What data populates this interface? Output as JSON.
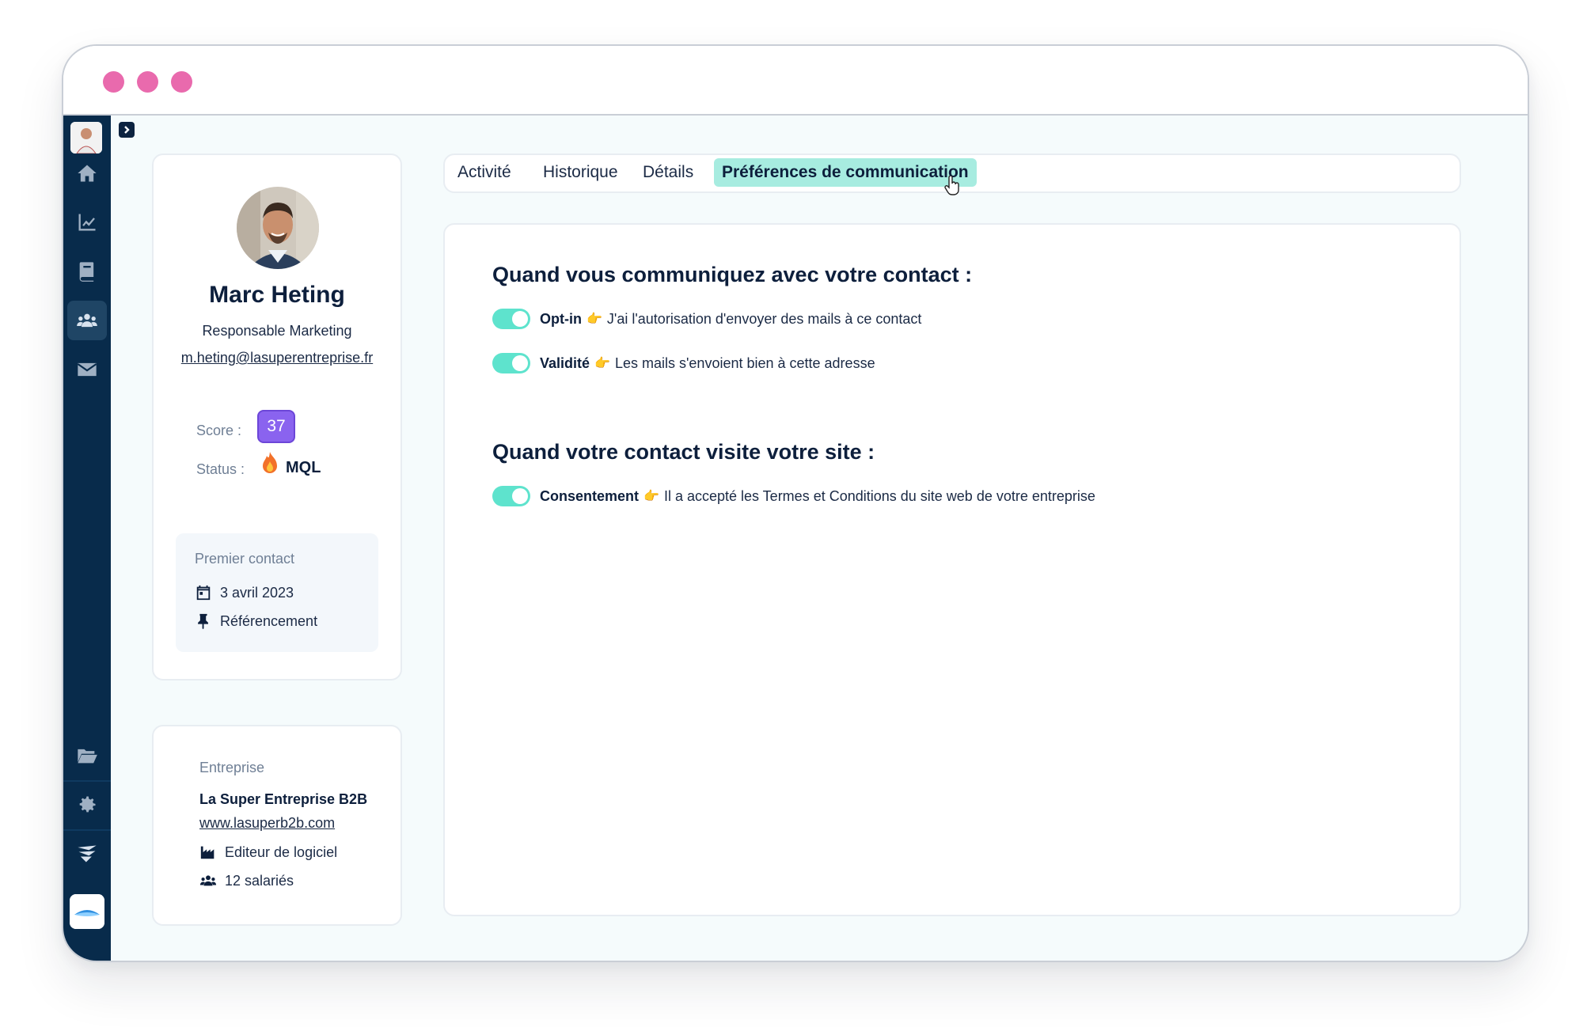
{
  "colors": {
    "accent": "#5ee3cd",
    "sidebar": "#082b4b",
    "score": "#8a63ef",
    "traffic": "#e96aad",
    "tab_active": "#a7ece0"
  },
  "icons": {
    "sidebar": [
      "home-icon",
      "chart-icon",
      "book-icon",
      "users-icon",
      "mail-icon",
      "folder-icon",
      "gear-icon",
      "brand-logo-icon"
    ],
    "status": "fire-icon",
    "first_contact": [
      "calendar-icon",
      "pin-icon"
    ],
    "company": [
      "factory-icon",
      "users-icon"
    ]
  },
  "profile": {
    "name": "Marc Heting",
    "role": "Responsable Marketing",
    "email": "m.heting@lasuperentreprise.fr",
    "score_label": "Score :",
    "score": "37",
    "status_label": "Status :",
    "status": "MQL"
  },
  "first_contact": {
    "title": "Premier contact",
    "date": "3 avril 2023",
    "source": "Référencement"
  },
  "company": {
    "title": "Entreprise",
    "name": "La Super Entreprise B2B",
    "website": "www.lasuperb2b.com",
    "industry": "Editeur de logiciel",
    "employees": "12 salariés"
  },
  "tabs": [
    {
      "label": "Activité"
    },
    {
      "label": "Historique"
    },
    {
      "label": "Détails"
    },
    {
      "label": "Préférences de communication",
      "active": true
    }
  ],
  "preferences": {
    "section1_title": "Quand vous communiquez avec votre contact :",
    "section2_title": "Quand votre contact visite votre site :",
    "items": [
      {
        "label": "Opt-in",
        "hand": "👉",
        "desc": "J'ai l'autorisation d'envoyer des mails à ce contact",
        "enabled": true
      },
      {
        "label": "Validité",
        "hand": "👉",
        "desc": "Les mails s'envoient bien à cette adresse",
        "enabled": true
      },
      {
        "label": "Consentement",
        "hand": "👉",
        "desc": "Il a accepté les Termes et Conditions du site web de votre entreprise",
        "enabled": true
      }
    ]
  }
}
